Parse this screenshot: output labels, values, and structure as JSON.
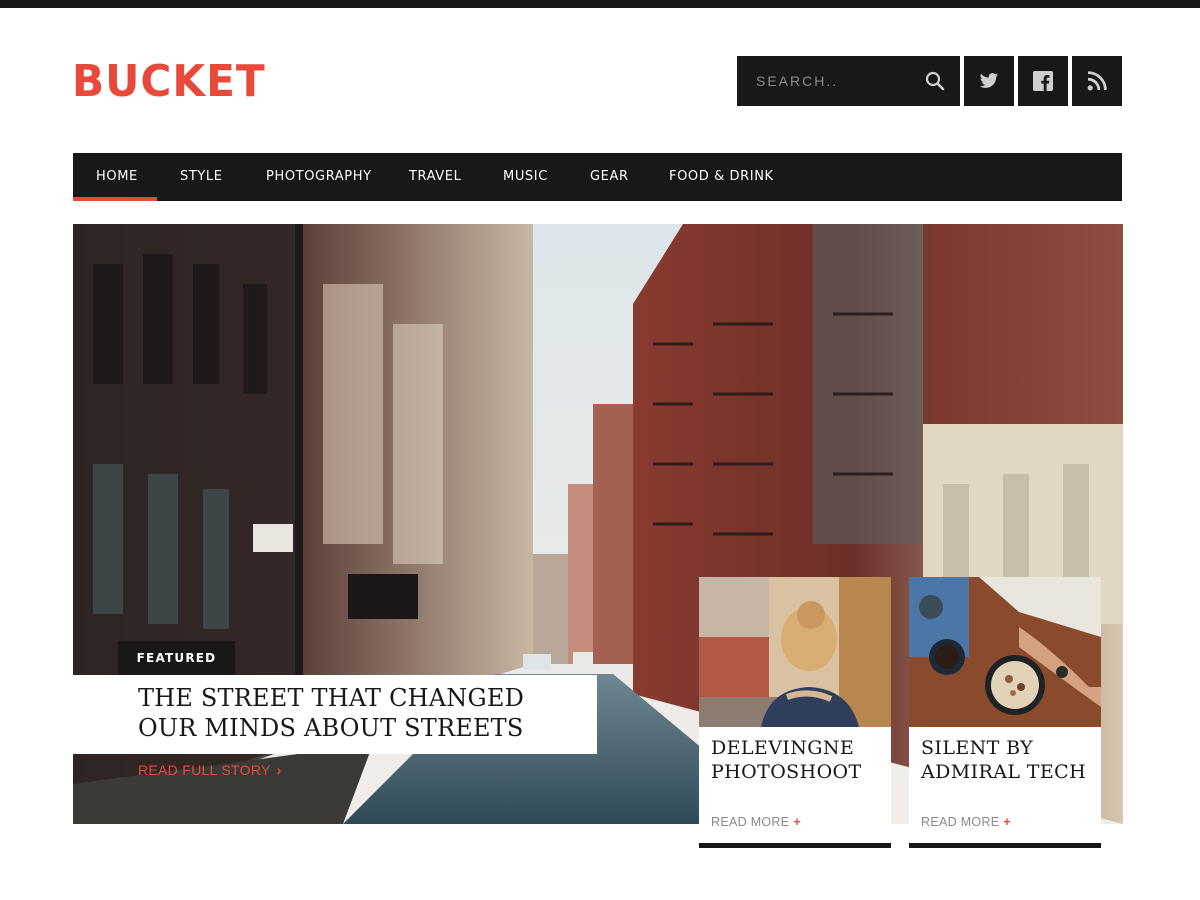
{
  "brand": {
    "logo_text": "BUCKET",
    "accent_color": "#e8493b",
    "dark_color": "#1a1718"
  },
  "search": {
    "placeholder": "SEARCH..",
    "icon": "search-icon"
  },
  "social": [
    {
      "name": "twitter",
      "icon": "twitter-icon"
    },
    {
      "name": "facebook",
      "icon": "facebook-icon"
    },
    {
      "name": "rss",
      "icon": "rss-icon"
    }
  ],
  "nav": {
    "active": "HOME",
    "items": [
      "HOME",
      "STYLE",
      "PHOTOGRAPHY",
      "TRAVEL",
      "MUSIC",
      "GEAR",
      "FOOD & DRINK"
    ]
  },
  "featured": {
    "tag": "FEATURED",
    "title": "THE STREET THAT CHANGED OUR MINDS ABOUT STREETS",
    "cta": "READ FULL STORY",
    "cta_icon": "chevron-right-icon"
  },
  "cards": [
    {
      "title": "DELEVINGNE PHOTOSHOOT",
      "cta": "READ MORE",
      "cta_icon": "+"
    },
    {
      "title": "SILENT BY ADMIRAL TECH",
      "cta": "READ MORE",
      "cta_icon": "+"
    }
  ]
}
